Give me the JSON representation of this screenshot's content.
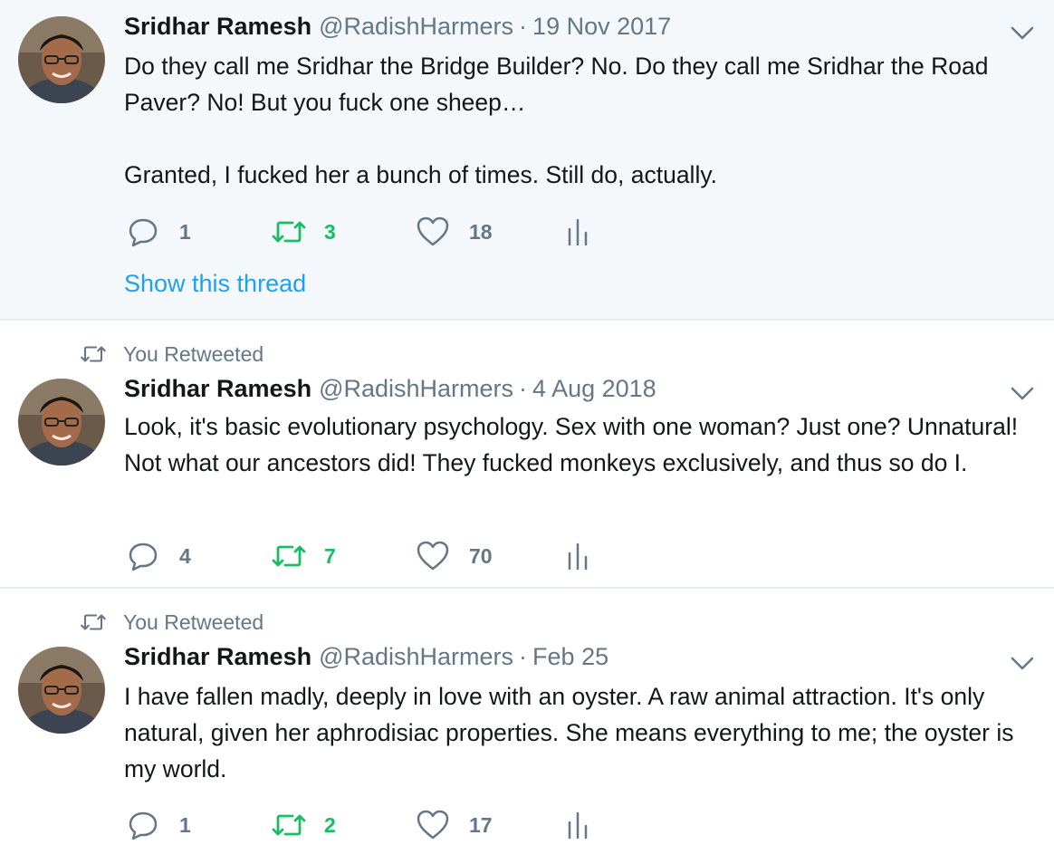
{
  "colors": {
    "text": "#14171a",
    "muted": "#657786",
    "link": "#1da1f2",
    "retweeted": "#17bf63",
    "highlight_bg": "#f5f8fa",
    "divider": "#e6ecf0"
  },
  "icons": {
    "reply": "reply-icon",
    "retweet": "retweet-icon",
    "like": "heart-icon",
    "analytics": "analytics-icon",
    "menu": "chevron-down-icon"
  },
  "tweets": [
    {
      "retweet_context": "",
      "author_name": "Sridhar Ramesh",
      "author_handle": "@RadishHarmers",
      "separator": "·",
      "date": "19 Nov 2017",
      "text": "Do they call me Sridhar the Bridge Builder? No. Do they call me Sridhar the Road Paver? No! But you fuck one sheep…\n\nGranted, I fucked her a bunch of times. Still do, actually.",
      "replies": "1",
      "retweets": "3",
      "likes": "18",
      "show_thread": "Show this thread"
    },
    {
      "retweet_context": "You Retweeted",
      "author_name": "Sridhar Ramesh",
      "author_handle": "@RadishHarmers",
      "separator": "·",
      "date": "4 Aug 2018",
      "text": "Look, it's basic evolutionary psychology. Sex with one woman? Just one? Unnatural! Not what our ancestors did! They fucked monkeys exclusively, and thus so do I.",
      "replies": "4",
      "retweets": "7",
      "likes": "70"
    },
    {
      "retweet_context": "You Retweeted",
      "author_name": "Sridhar Ramesh",
      "author_handle": "@RadishHarmers",
      "separator": "·",
      "date": "Feb 25",
      "text": "I have fallen madly, deeply in love with an oyster. A raw animal attraction. It's only natural, given her aphrodisiac properties. She means everything to me; the oyster is my world.",
      "replies": "1",
      "retweets": "2",
      "likes": "17"
    }
  ]
}
